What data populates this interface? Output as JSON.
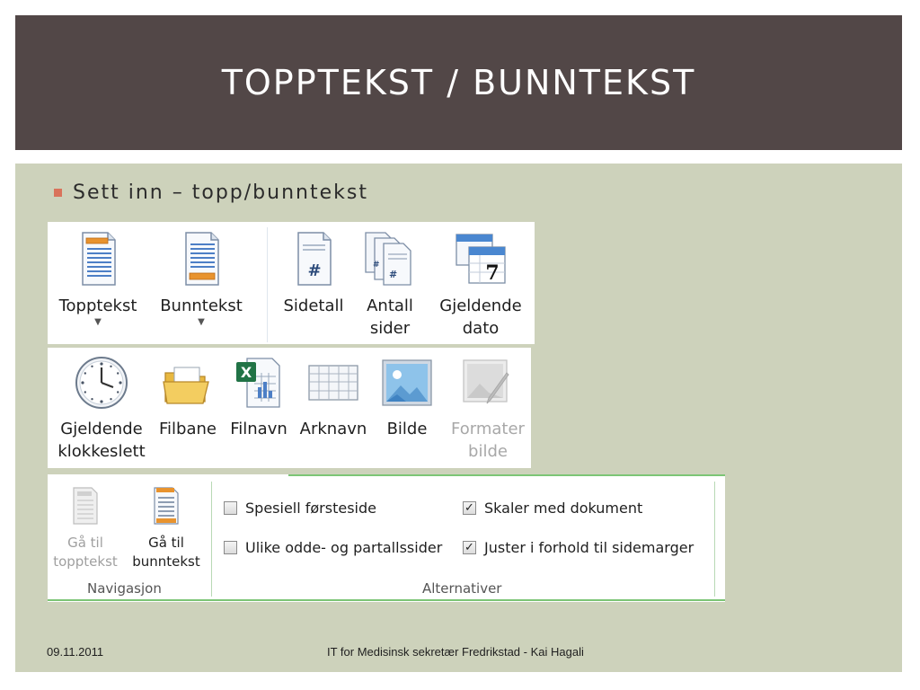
{
  "slide": {
    "title": "TOPPTEKST / BUNNTEKST",
    "bullet": "Sett inn – topp/bunntekst",
    "footer_date": "09.11.2011",
    "footer_text": "IT for Medisinsk sekretær Fredrikstad - Kai Hagali"
  },
  "ribbon1": {
    "topptekst": "Topptekst",
    "bunntekst": "Bunntekst",
    "sidetall": "Sidetall",
    "antall_1": "Antall",
    "antall_2": "sider",
    "dato_1": "Gjeldende",
    "dato_2": "dato",
    "dato_icon_number": "7"
  },
  "ribbon2": {
    "klokke_1": "Gjeldende",
    "klokke_2": "klokkeslett",
    "filbane": "Filbane",
    "filnavn": "Filnavn",
    "arknavn": "Arknavn",
    "bilde": "Bilde",
    "formater_1": "Formater",
    "formater_2": "bilde"
  },
  "ribbon3": {
    "ga_topp_1": "Gå til",
    "ga_topp_2": "topptekst",
    "ga_bunn_1": "Gå til",
    "ga_bunn_2": "bunntekst",
    "nav_group": "Navigasjon",
    "alt_group": "Alternativer",
    "options": {
      "spesiell": {
        "label": "Spesiell førsteside",
        "checked": false
      },
      "ulike": {
        "label": "Ulike odde- og partallssider",
        "checked": false
      },
      "skaler": {
        "label": "Skaler med dokument",
        "checked": true
      },
      "juster": {
        "label": "Juster i forhold til sidemarger",
        "checked": true
      }
    }
  },
  "colors": {
    "title_bg": "#524747",
    "content_bg": "#cdd2bb",
    "bullet": "#d9735b",
    "accent_green": "#7cc576"
  }
}
